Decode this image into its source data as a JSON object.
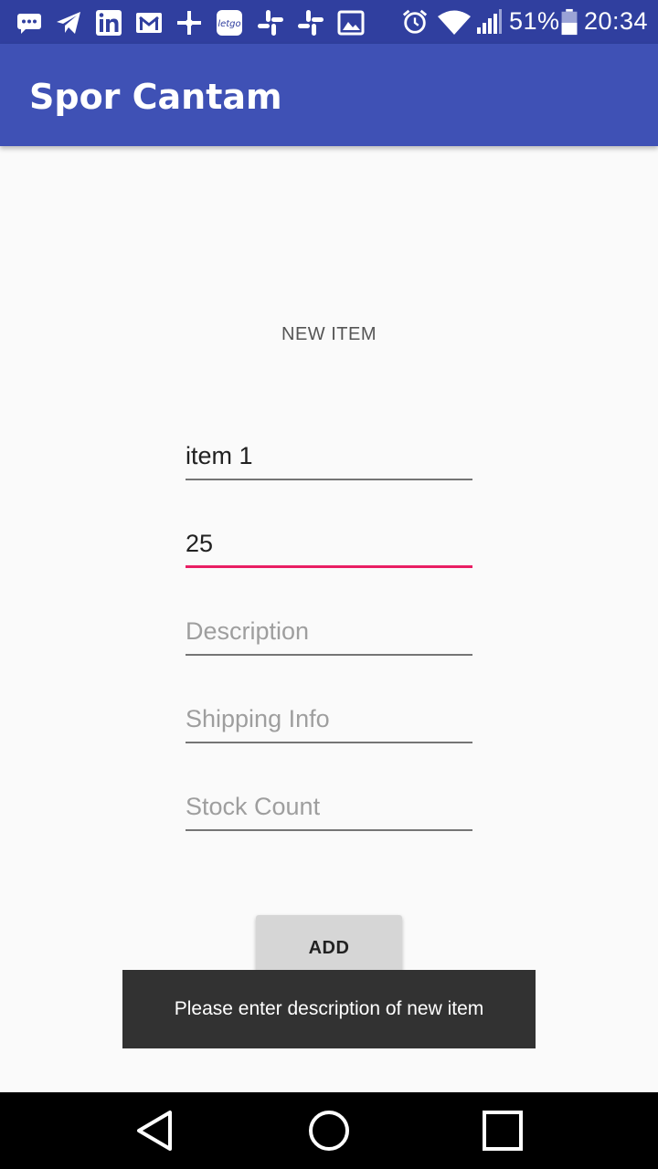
{
  "status_bar": {
    "notification_icons": [
      "message-icon",
      "telegram-icon",
      "linkedin-icon",
      "gmail-icon",
      "cross-app-icon",
      "letgo-icon",
      "slack-icon",
      "slack-icon",
      "image-icon"
    ],
    "battery_percent": "51%",
    "time": "20:34"
  },
  "app_bar": {
    "title": "Spor Cantam"
  },
  "form": {
    "heading": "NEW ITEM",
    "name": {
      "value": "item 1",
      "placeholder": ""
    },
    "price": {
      "value": "25",
      "placeholder": ""
    },
    "description": {
      "value": "",
      "placeholder": "Description"
    },
    "shipping": {
      "value": "",
      "placeholder": "Shipping Info"
    },
    "stock": {
      "value": "",
      "placeholder": "Stock Count"
    },
    "add_label": "ADD"
  },
  "toast": {
    "message": "Please enter description of new item"
  },
  "colors": {
    "primary": "#3f51b5",
    "primary_dark": "#303f9f",
    "accent": "#e91e63"
  }
}
